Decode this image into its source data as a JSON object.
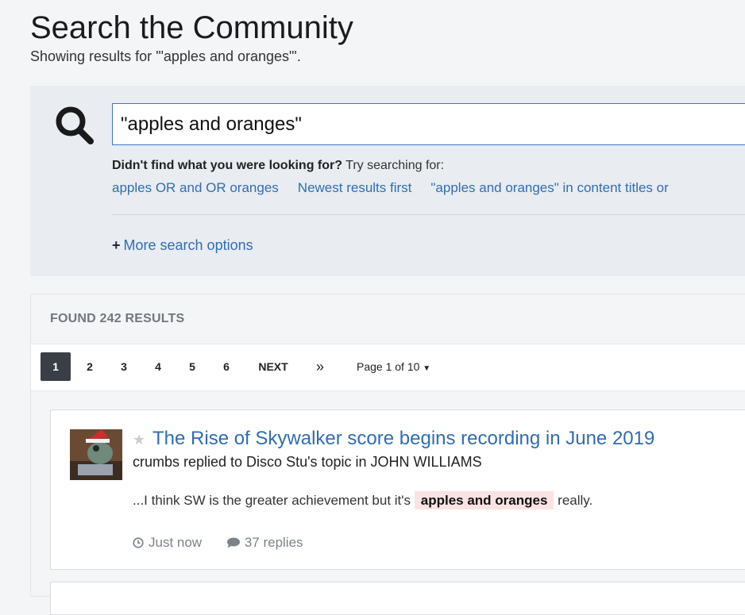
{
  "header": {
    "title": "Search the Community",
    "subtitle": "Showing results for '\"apples and oranges\"'."
  },
  "search": {
    "value": "\"apples and oranges\"",
    "icon": "search-icon",
    "suggest_bold": "Didn't find what you were looking for?",
    "suggest_rest": " Try searching for:",
    "suggestions": [
      "apples OR and OR oranges",
      "Newest results first",
      "\"apples and oranges\" in content titles or"
    ],
    "more_options": "More search options",
    "more_options_icon": "plus-icon"
  },
  "results": {
    "found_label": "FOUND 242 RESULTS",
    "pages": [
      "1",
      "2",
      "3",
      "4",
      "5",
      "6"
    ],
    "next_label": "NEXT",
    "last_label": "»",
    "page_of": "Page 1 of 10",
    "items": [
      {
        "title": "The Rise of Skywalker score begins recording in June 2019",
        "meta": "crumbs replied to Disco Stu's topic in JOHN WILLIAMS",
        "snippet_before": "...I think SW is the greater achievement but it's",
        "snippet_highlight": "apples and oranges",
        "snippet_after": "really.",
        "time": "Just now",
        "replies": "37 replies"
      }
    ]
  },
  "colors": {
    "link": "#2f6db5",
    "active_page": "#3a3f45",
    "highlight": "#fbe3e3"
  }
}
